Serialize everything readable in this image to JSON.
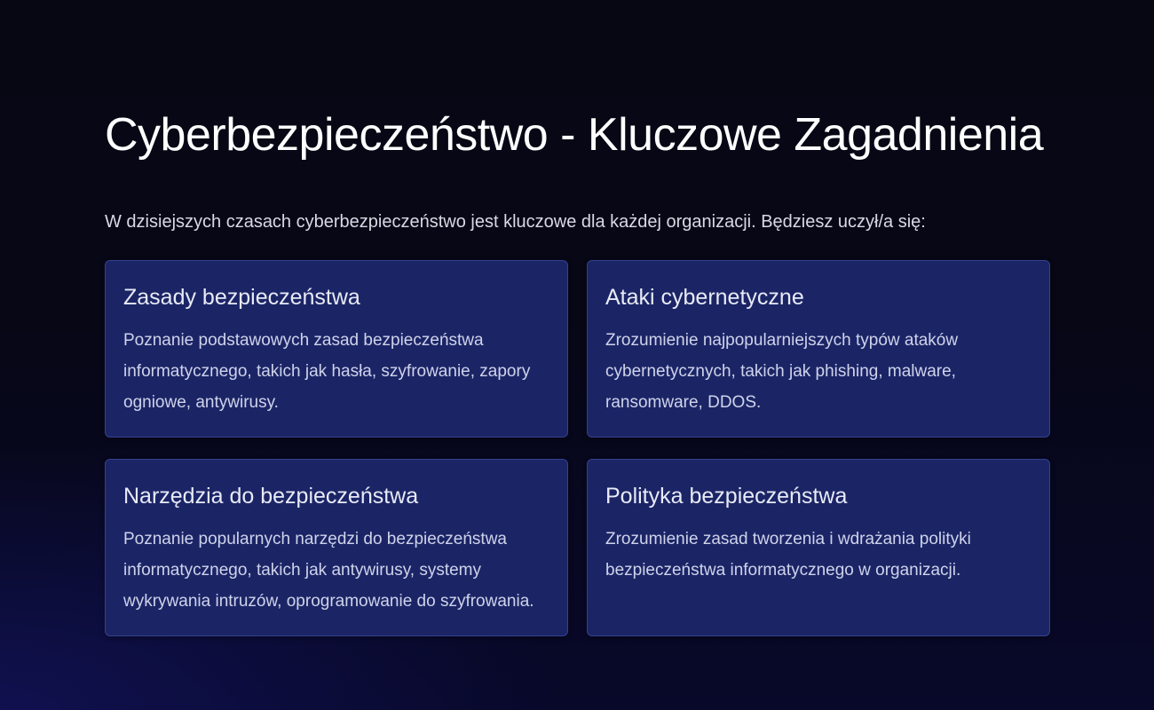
{
  "header": {
    "title": "Cyberbezpieczeństwo - Kluczowe Zagadnienia",
    "intro": "W dzisiejszych czasach cyberbezpieczeństwo jest kluczowe dla każdej organizacji. Będziesz uczył/a się:"
  },
  "cards": [
    {
      "title": "Zasady bezpieczeństwa",
      "text": "Poznanie podstawowych zasad bezpieczeństwa informatycznego, takich jak hasła, szyfrowanie, zapory ogniowe, antywirusy."
    },
    {
      "title": "Ataki cybernetyczne",
      "text": "Zrozumienie najpopularniejszych typów ataków cybernetycznych, takich jak phishing, malware, ransomware, DDOS."
    },
    {
      "title": "Narzędzia do bezpieczeństwa",
      "text": "Poznanie popularnych narzędzi do bezpieczeństwa informatycznego, takich jak antywirusy, systemy wykrywania intruzów, oprogramowanie do szyfrowania."
    },
    {
      "title": "Polityka bezpieczeństwa",
      "text": "Zrozumienie zasad tworzenia i wdrażania polityki bezpieczeństwa informatycznego w organizacji."
    }
  ],
  "colors": {
    "background": "#070714",
    "card_background": "#1b2566",
    "card_border": "#34418c",
    "title_text": "#ffffff",
    "body_text": "#cfd3ea"
  }
}
